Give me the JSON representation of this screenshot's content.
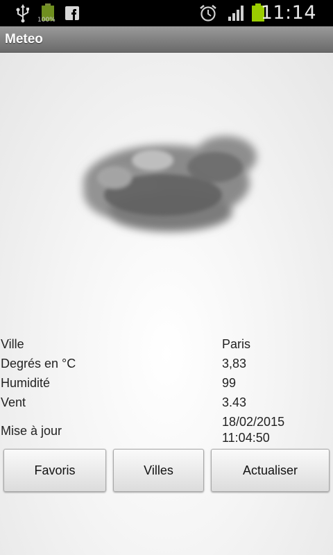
{
  "status_bar": {
    "battery_small_label": "100%",
    "time": "11:14"
  },
  "app": {
    "title": "Meteo"
  },
  "weather": {
    "icon": "cloud-icon",
    "rows": [
      {
        "label": "Ville",
        "value": "Paris"
      },
      {
        "label": "Degrés en °C",
        "value": "3,83"
      },
      {
        "label": "Humidité",
        "value": "99"
      },
      {
        "label": "Vent",
        "value": "3.43"
      },
      {
        "label": "Mise à jour",
        "value_date": "18/02/2015",
        "value_time": "11:04:50"
      }
    ]
  },
  "buttons": {
    "favoris": "Favoris",
    "villes": "Villes",
    "actualiser": "Actualiser"
  },
  "colors": {
    "battery_green": "#9acd00",
    "title_bar": "#7f7f7f"
  }
}
